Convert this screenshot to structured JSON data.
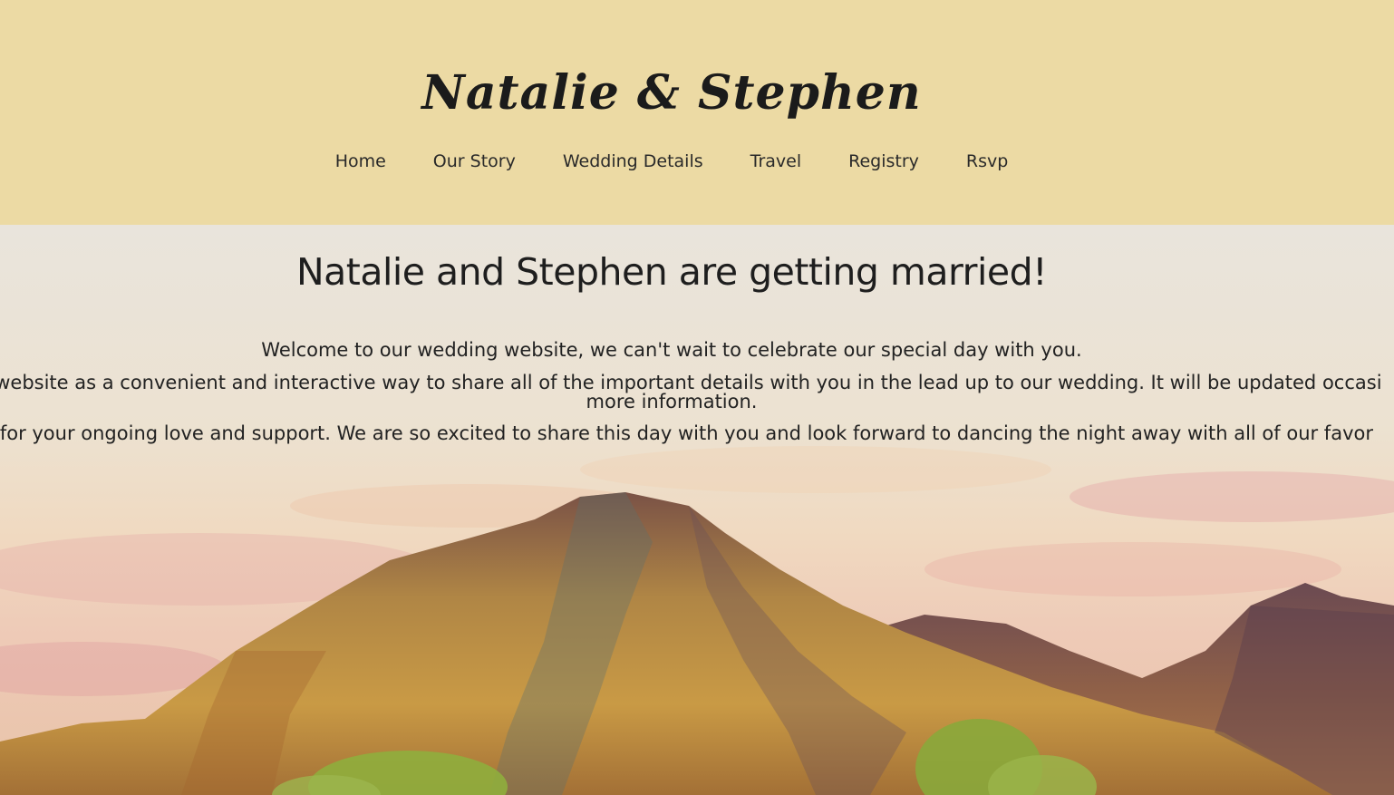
{
  "header": {
    "site_title": "Natalie & Stephen",
    "nav": [
      "Home",
      "Our Story",
      "Wedding Details",
      "Travel",
      "Registry",
      "Rsvp"
    ]
  },
  "hero": {
    "heading": "Natalie and Stephen are getting married!",
    "paragraphs": [
      "Welcome to our wedding website, we can't wait to celebrate our special day with you.",
      "his website as a convenient and interactive way to share all of the important details with you in the lead up to our wedding. It will be updated occasi",
      "more information.",
      "ou for your ongoing love and support. We are so excited to share this day with you and look forward to dancing the night away with all of our favor"
    ]
  },
  "colors": {
    "header_bg": "#ecdaa4",
    "text": "#1e1e1e"
  }
}
